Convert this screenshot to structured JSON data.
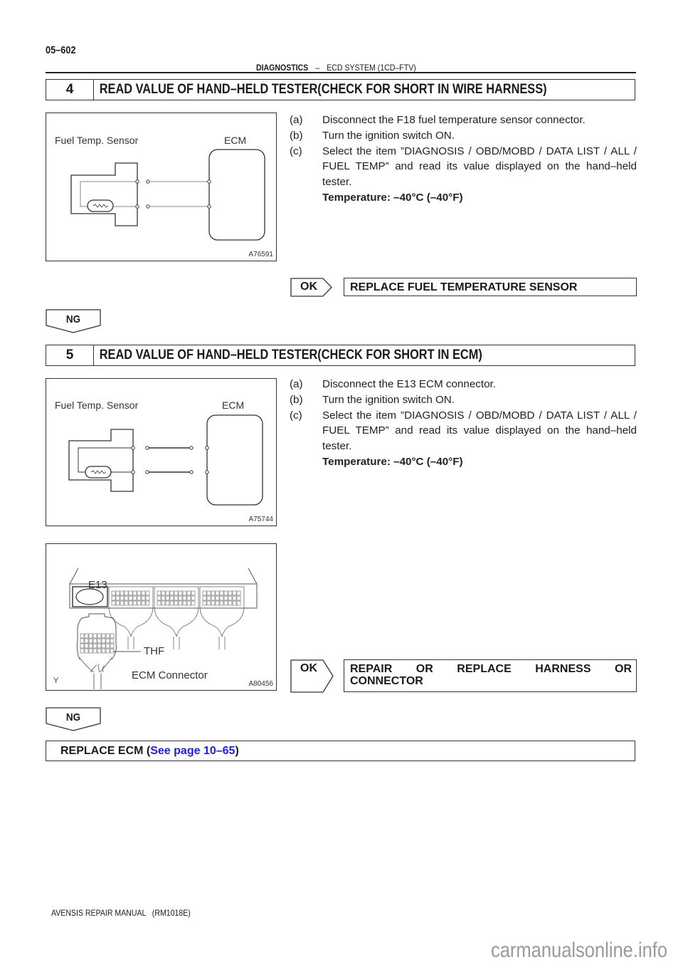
{
  "header": {
    "page_number": "05–602",
    "section": "DIAGNOSTICS",
    "separator": "–",
    "subsection": "ECD SYSTEM (1CD–FTV)"
  },
  "steps": [
    {
      "number": "4",
      "title": "READ VALUE OF HAND–HELD TESTER(CHECK FOR SHORT IN WIRE HARNESS)",
      "figure": {
        "code": "A76591",
        "label_left": "Fuel Temp. Sensor",
        "label_right": "ECM"
      },
      "instructions": [
        {
          "mark": "(a)",
          "text": "Disconnect the F18 fuel temperature sensor connector."
        },
        {
          "mark": "(b)",
          "text": "Turn the ignition switch ON."
        },
        {
          "mark": "(c)",
          "text": "Select the item ”DIAGNOSIS / OBD/MOBD / DATA LIST / ALL / FUEL TEMP” and read its value displayed on the hand–held tester."
        }
      ],
      "spec": "Temperature: –40°C (–40°F)",
      "ok_label": "OK",
      "ok_action": "REPLACE FUEL TEMPERATURE SENSOR",
      "ng_label": "NG"
    },
    {
      "number": "5",
      "title": "READ VALUE OF HAND–HELD TESTER(CHECK FOR SHORT IN ECM)",
      "figure": {
        "code": "A75744",
        "label_left": "Fuel Temp. Sensor",
        "label_right": "ECM"
      },
      "figure2": {
        "code": "A80456",
        "connector_id": "E13",
        "terminal_label": "THF",
        "caption": "ECM Connector",
        "corner_mark": "Y"
      },
      "instructions": [
        {
          "mark": "(a)",
          "text": "Disconnect the E13 ECM connector."
        },
        {
          "mark": "(b)",
          "text": "Turn the ignition switch ON."
        },
        {
          "mark": "(c)",
          "text": "Select the item ”DIAGNOSIS / OBD/MOBD / DATA LIST / ALL / FUEL TEMP” and read its value displayed on the hand–held tester."
        }
      ],
      "spec": "Temperature: –40°C (–40°F)",
      "ok_label": "OK",
      "ok_action": "REPAIR OR REPLACE HARNESS OR CONNECTOR",
      "ng_label": "NG"
    }
  ],
  "final": {
    "prefix": "REPLACE ECM (",
    "link_text": "See page 10–65",
    "suffix": ")",
    "link_color": "#1a1aff"
  },
  "footer": {
    "manual": "AVENSIS REPAIR MANUAL   (RM1018E)",
    "watermark": "carmanualsonline.info"
  }
}
